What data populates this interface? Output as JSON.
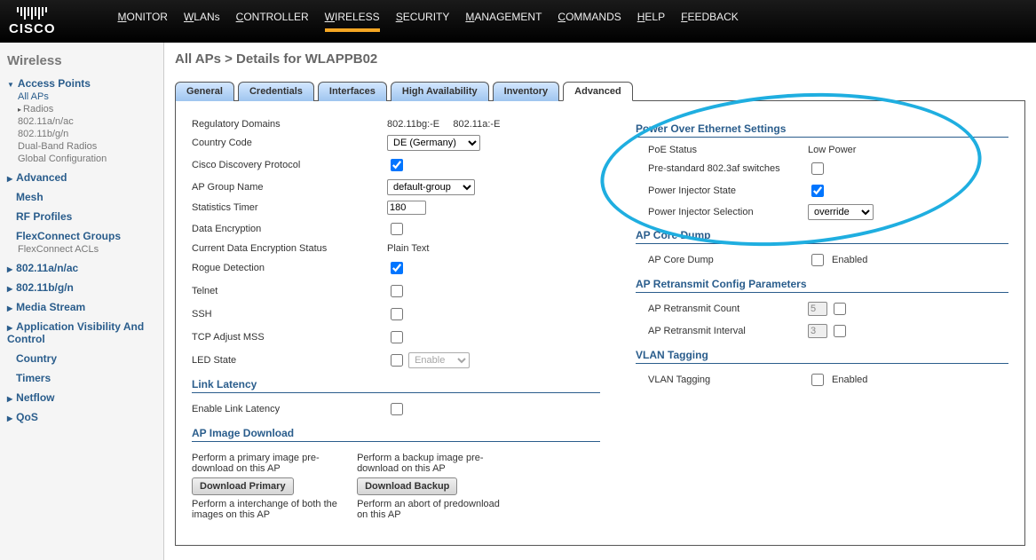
{
  "brand": {
    "name": "CISCO"
  },
  "topnav": {
    "items": [
      {
        "label": "MONITOR",
        "hot": "M",
        "rest": "ONITOR"
      },
      {
        "label": "WLANs",
        "hot": "W",
        "rest": "LANs"
      },
      {
        "label": "CONTROLLER",
        "hot": "C",
        "rest": "ONTROLLER"
      },
      {
        "label": "WIRELESS",
        "hot": "W",
        "rest": "IRELESS"
      },
      {
        "label": "SECURITY",
        "hot": "S",
        "rest": "ECURITY"
      },
      {
        "label": "MANAGEMENT",
        "hot": "M",
        "rest": "ANAGEMENT"
      },
      {
        "label": "COMMANDS",
        "hot": "C",
        "rest": "OMMANDS"
      },
      {
        "label": "HELP",
        "hot": "H",
        "rest": "ELP"
      },
      {
        "label": "FEEDBACK",
        "hot": "F",
        "rest": "EEDBACK"
      }
    ],
    "active_index": 3
  },
  "sidebar": {
    "title": "Wireless",
    "access_points": {
      "label": "Access Points",
      "all_aps": "All APs",
      "radios": "Radios",
      "radio_items": [
        "802.11a/n/ac",
        "802.11b/g/n",
        "Dual-Band Radios"
      ],
      "global_config": "Global Configuration"
    },
    "groups": [
      "Advanced",
      "Mesh",
      "RF Profiles",
      "FlexConnect Groups",
      "802.11a/n/ac",
      "802.11b/g/n",
      "Media Stream",
      "Application Visibility And Control",
      "Country",
      "Timers",
      "Netflow",
      "QoS"
    ],
    "flexconnect_sub": "FlexConnect ACLs"
  },
  "page": {
    "title": "All APs > Details for WLAPPB02"
  },
  "tabs": {
    "items": [
      "General",
      "Credentials",
      "Interfaces",
      "High Availability",
      "Inventory",
      "Advanced"
    ],
    "active_index": 5
  },
  "left": {
    "rows": {
      "reg_domains_label": "Regulatory Domains",
      "reg_domains_value": "802.11bg:-E     802.11a:-E",
      "country_code_label": "Country Code",
      "country_code_value": "DE (Germany)",
      "cdp_label": "Cisco Discovery Protocol",
      "cdp_checked": true,
      "ap_group_label": "AP Group Name",
      "ap_group_value": "default-group",
      "stats_timer_label": "Statistics Timer",
      "stats_timer_value": "180",
      "data_enc_label": "Data Encryption",
      "data_enc_checked": false,
      "cur_enc_label": "Current Data Encryption Status",
      "cur_enc_value": "Plain Text",
      "rogue_label": "Rogue Detection",
      "rogue_checked": true,
      "telnet_label": "Telnet",
      "telnet_checked": false,
      "ssh_label": "SSH",
      "ssh_checked": false,
      "tcp_label": "TCP Adjust MSS",
      "tcp_checked": false,
      "led_label": "LED State",
      "led_checked": false,
      "led_select": "Enable"
    },
    "sections": {
      "link_latency": "Link Latency",
      "enable_link_latency": "Enable Link Latency",
      "ap_image_download": "AP Image Download",
      "primary_text": "Perform a primary image pre-download on this AP",
      "primary_btn": "Download Primary",
      "primary_text2": "Perform a interchange of both the images on this AP",
      "backup_text": "Perform a backup image pre-download on this AP",
      "backup_btn": "Download Backup",
      "backup_text2": "Perform an abort of predownload on this AP"
    }
  },
  "right": {
    "poe_section": "Power Over Ethernet Settings",
    "poe_status_label": "PoE Status",
    "poe_status_value": "Low Power",
    "prestd_label": "Pre-standard 802.3af switches",
    "prestd_checked": false,
    "pinj_state_label": "Power Injector State",
    "pinj_state_checked": true,
    "pinj_sel_label": "Power Injector Selection",
    "pinj_sel_value": "override",
    "core_section": "AP Core Dump",
    "core_label": "AP Core Dump",
    "core_checked": false,
    "core_enable": "Enabled",
    "retx_section": "AP Retransmit Config Parameters",
    "retx_count_label": "AP Retransmit Count",
    "retx_count_value": "5",
    "retx_int_label": "AP Retransmit Interval",
    "retx_int_value": "3",
    "vlan_section": "VLAN Tagging",
    "vlan_label": "VLAN Tagging",
    "vlan_checked": false,
    "vlan_enable": "Enabled"
  }
}
